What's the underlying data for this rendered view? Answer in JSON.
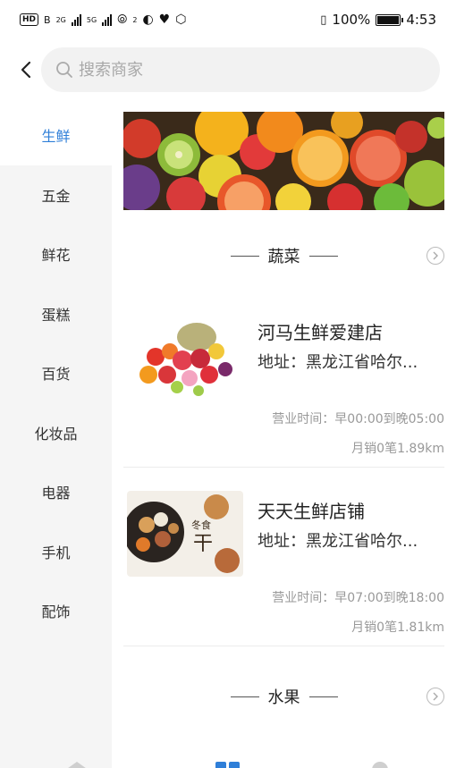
{
  "status_bar": {
    "hd_badge": "HD",
    "sim_label": "B",
    "net1": "2G",
    "net2": "5G",
    "hotspot_sup": "2",
    "battery_text": "100%",
    "battery_level": 1.0,
    "time": "4:53"
  },
  "search": {
    "placeholder": "搜索商家"
  },
  "sidebar": {
    "items": [
      {
        "label": "生鲜",
        "active": true
      },
      {
        "label": "五金"
      },
      {
        "label": "鲜花"
      },
      {
        "label": "蛋糕"
      },
      {
        "label": "百货"
      },
      {
        "label": "化妆品"
      },
      {
        "label": "电器"
      },
      {
        "label": "手机"
      },
      {
        "label": "配饰"
      }
    ]
  },
  "sections": [
    {
      "title": "蔬菜",
      "shops": [
        {
          "name": "河马生鲜爱建店",
          "address": "地址：黑龙江省哈尔...",
          "hours": "营业时间：早00:00到晚05:00",
          "sales": "月销0笔1.89km"
        },
        {
          "name": "天天生鲜店铺",
          "address": "地址：黑龙江省哈尔...",
          "hours": "营业时间：早07:00到晚18:00",
          "sales": "月销0笔1.81km"
        }
      ]
    },
    {
      "title": "水果"
    }
  ],
  "colors": {
    "accent": "#2f7fd8",
    "sidebar_bg": "#f5f5f5",
    "muted_text": "#999999"
  },
  "icons": {
    "back": "chevron-left-icon",
    "search": "search-icon",
    "more": "chevron-right-circle-icon"
  }
}
